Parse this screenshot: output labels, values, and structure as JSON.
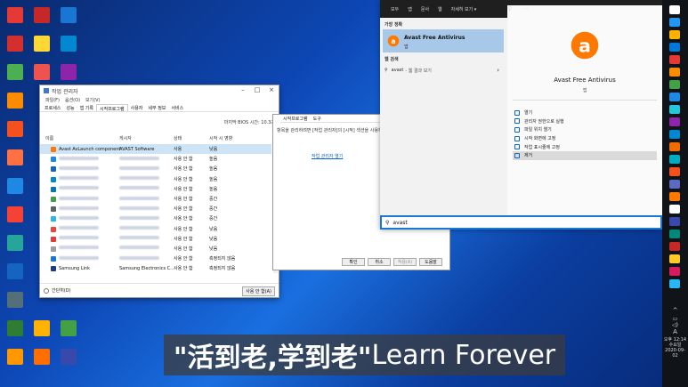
{
  "desktop": {
    "icon_colors": [
      "#e53935",
      "#d32f2f",
      "#4caf50",
      "#fb8c00",
      "#f4511e",
      "#ff7043",
      "#1e88e5",
      "#f44336",
      "#26a69a",
      "#1565c0",
      "#546e7a",
      "#2e7d32",
      "#ff9800",
      "#c62828",
      "#1976d2",
      "#fdd835",
      "#0288d1",
      "#ef5350",
      "#8e24aa",
      "#ffb300",
      "#43a047",
      "#ff6f00",
      "#3949ab",
      "#00897b",
      "#e64a19"
    ]
  },
  "task_manager": {
    "title": "작업 관리자",
    "menu": [
      "파일(F)",
      "옵션(O)",
      "보기(V)"
    ],
    "tabs": [
      "프로세스",
      "성능",
      "앱 기록",
      "시작프로그램",
      "사용자",
      "세부 정보",
      "서비스"
    ],
    "active_tab": "시작프로그램",
    "bios_label": "마지막 BIOS 시간:",
    "bios_value": "10.3초",
    "columns": [
      "이름",
      "게시자",
      "상태",
      "시작 시 영향"
    ],
    "rows": [
      {
        "name": "Avast AvLaunch component",
        "publisher": "AVAST Software",
        "status": "사용",
        "impact": "낮음",
        "color": "#ff7800",
        "selected": true
      },
      {
        "name": "",
        "publisher": "",
        "status": "사용 안 함",
        "impact": "높음",
        "color": "#1e88e5"
      },
      {
        "name": "",
        "publisher": "",
        "status": "사용 안 함",
        "impact": "높음",
        "color": "#1565c0"
      },
      {
        "name": "",
        "publisher": "",
        "status": "사용 안 함",
        "impact": "높음",
        "color": "#0288d1"
      },
      {
        "name": "",
        "publisher": "",
        "status": "사용 안 함",
        "impact": "높음",
        "color": "#0277bd"
      },
      {
        "name": "",
        "publisher": "",
        "status": "사용 안 함",
        "impact": "중간",
        "color": "#43a047"
      },
      {
        "name": "",
        "publisher": "",
        "status": "사용 안 함",
        "impact": "중간",
        "color": "#616161"
      },
      {
        "name": "",
        "publisher": "",
        "status": "사용 안 함",
        "impact": "중간",
        "color": "#29b6f6"
      },
      {
        "name": "",
        "publisher": "",
        "status": "사용 안 함",
        "impact": "낮음",
        "color": "#f44336"
      },
      {
        "name": "",
        "publisher": "",
        "status": "사용 안 함",
        "impact": "낮음",
        "color": "#e53935"
      },
      {
        "name": "",
        "publisher": "",
        "status": "사용 안 함",
        "impact": "낮음",
        "color": "#9e9e9e"
      },
      {
        "name": "",
        "publisher": "",
        "status": "사용 안 함",
        "impact": "측정되지 않음",
        "color": "#1976d2"
      },
      {
        "name": "Samsung Link",
        "publisher": "Samsung Electronics C...",
        "status": "사용 안 함",
        "impact": "측정되지 않음",
        "color": "#1e3a8a"
      }
    ],
    "footer_left": "간단히(D)",
    "footer_button": "사용 안 함(A)"
  },
  "sysconfig": {
    "tabs": [
      "시작프로그램",
      "도구"
    ],
    "message": "항목을 관리하려면 [작업 관리자]의 [시작] 섹션을 사용하세요.",
    "link": "작업 관리자 열기",
    "buttons": [
      "확인",
      "취소",
      "적용(A)",
      "도움말"
    ]
  },
  "start_panel": {
    "header_tabs": [
      "모두",
      "앱",
      "문서",
      "웹",
      "자세히 보기"
    ],
    "best_match_title": "가장 정확",
    "best_match_name": "Avast Free Antivirus",
    "best_match_type": "앱",
    "web_title": "웹 검색",
    "web_query": "avast",
    "web_suffix": "- 웹 결과 보기",
    "app_name": "Avast Free Antivirus",
    "app_type": "앱",
    "actions": [
      "열기",
      "관리자 권한으로 실행",
      "파일 위치 열기",
      "시작 화면에 고정",
      "작업 표시줄에 고정",
      "제거"
    ],
    "search_value": "avast"
  },
  "taskbar": {
    "ime": "A",
    "time_period": "오후",
    "time": "12:14",
    "weekday": "수요일",
    "date": "2020-09-02"
  },
  "caption": {
    "chinese": "\"活到老,学到老\"",
    "english": "Learn Forever"
  }
}
